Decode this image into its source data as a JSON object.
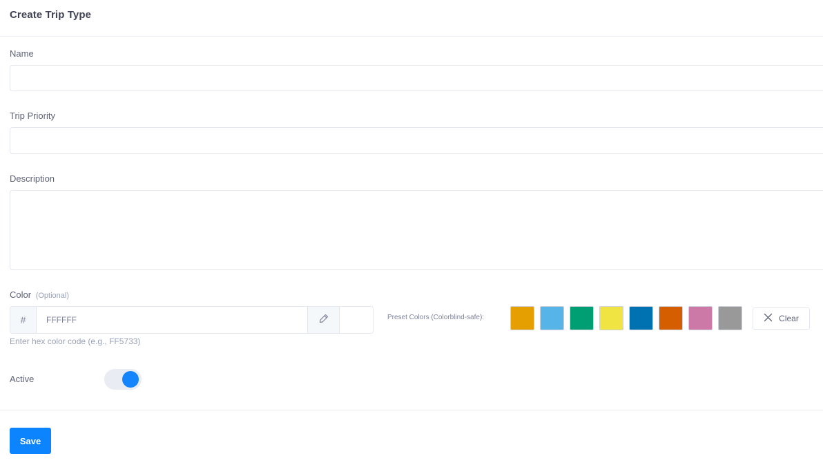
{
  "header": {
    "title": "Create Trip Type"
  },
  "form": {
    "name_label": "Name",
    "name_value": "",
    "priority_label": "Trip Priority",
    "priority_value": "",
    "description_label": "Description",
    "description_value": "",
    "color_label": "Color",
    "color_optional": "(Optional)",
    "color_prefix": "#",
    "color_placeholder": "FFFFFF",
    "color_hint": "Enter hex color code (e.g., FF5733)",
    "preset_label": "Preset Colors (Colorblind-safe):",
    "presets": [
      "#e69f00",
      "#56b4e9",
      "#009e73",
      "#f0e442",
      "#0072b2",
      "#d55e00",
      "#cc79a7",
      "#999999"
    ],
    "clear_label": "Clear",
    "active_label": "Active",
    "active": true,
    "save_label": "Save"
  },
  "icons": {
    "picker": "pencil-icon",
    "clear": "close-icon"
  }
}
